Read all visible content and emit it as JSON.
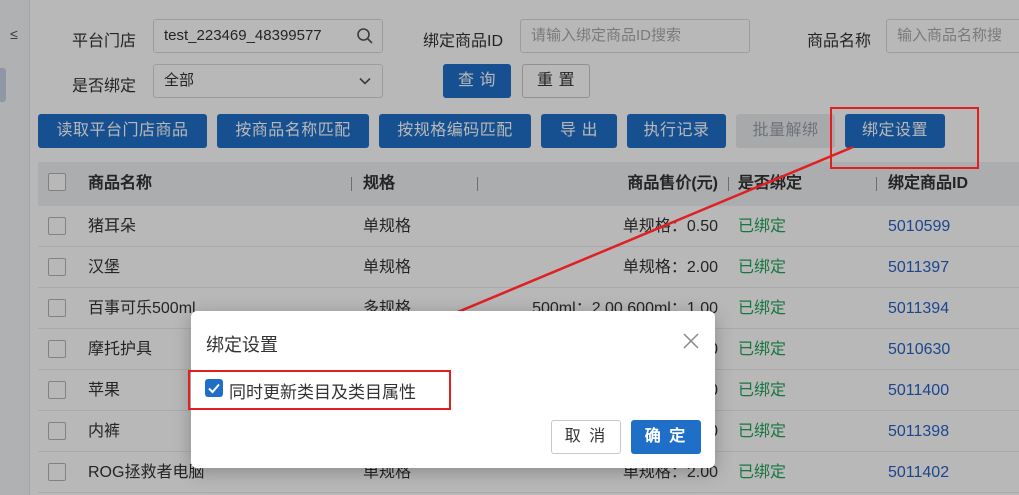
{
  "filters": {
    "store_label": "平台门店",
    "store_value": "test_223469_48399577",
    "bound_id_label": "绑定商品ID",
    "bound_id_placeholder": "请输入绑定商品ID搜索",
    "name_label": "商品名称",
    "name_placeholder": "输入商品名称搜",
    "is_bound_label": "是否绑定",
    "is_bound_value": "全部",
    "query_button": "查 询",
    "reset_button": "重 置"
  },
  "toolbar": {
    "read_store": "读取平台门店商品",
    "match_by_name": "按商品名称匹配",
    "match_by_spec": "按规格编码匹配",
    "export": "导 出",
    "exec_log": "执行记录",
    "batch_unbind": "批量解绑",
    "bind_settings": "绑定设置"
  },
  "table": {
    "headers": [
      "商品名称",
      "规格",
      "商品售价(元)",
      "是否绑定",
      "绑定商品ID"
    ],
    "rows": [
      {
        "name": "猪耳朵",
        "spec": "单规格",
        "price": "单规格：0.50",
        "bound": "已绑定",
        "id": "5010599"
      },
      {
        "name": "汉堡",
        "spec": "单规格",
        "price": "单规格：2.00",
        "bound": "已绑定",
        "id": "5011397"
      },
      {
        "name": "百事可乐500ml",
        "spec": "多规格",
        "price": "500ml：2.00,600ml：1.00",
        "bound": "已绑定",
        "id": "5011394"
      },
      {
        "name": "摩托护具",
        "spec": "",
        "price": "0",
        "bound": "已绑定",
        "id": "5010630"
      },
      {
        "name": "苹果",
        "spec": "",
        "price": "0",
        "bound": "已绑定",
        "id": "5011400"
      },
      {
        "name": "内裤",
        "spec": "",
        "price": "0",
        "bound": "已绑定",
        "id": "5011398"
      },
      {
        "name": "ROG拯救者电脑",
        "spec": "单规格",
        "price": "单规格：2.00",
        "bound": "已绑定",
        "id": "5011402"
      }
    ]
  },
  "modal": {
    "title": "绑定设置",
    "checkbox_label": "同时更新类目及类目属性",
    "checkbox_checked": true,
    "cancel": "取 消",
    "ok": "确 定"
  },
  "colors": {
    "primary": "#1f6fc9",
    "bound_green": "#23a45a",
    "id_blue": "#2a62c6",
    "annotation_red": "#e02020"
  }
}
